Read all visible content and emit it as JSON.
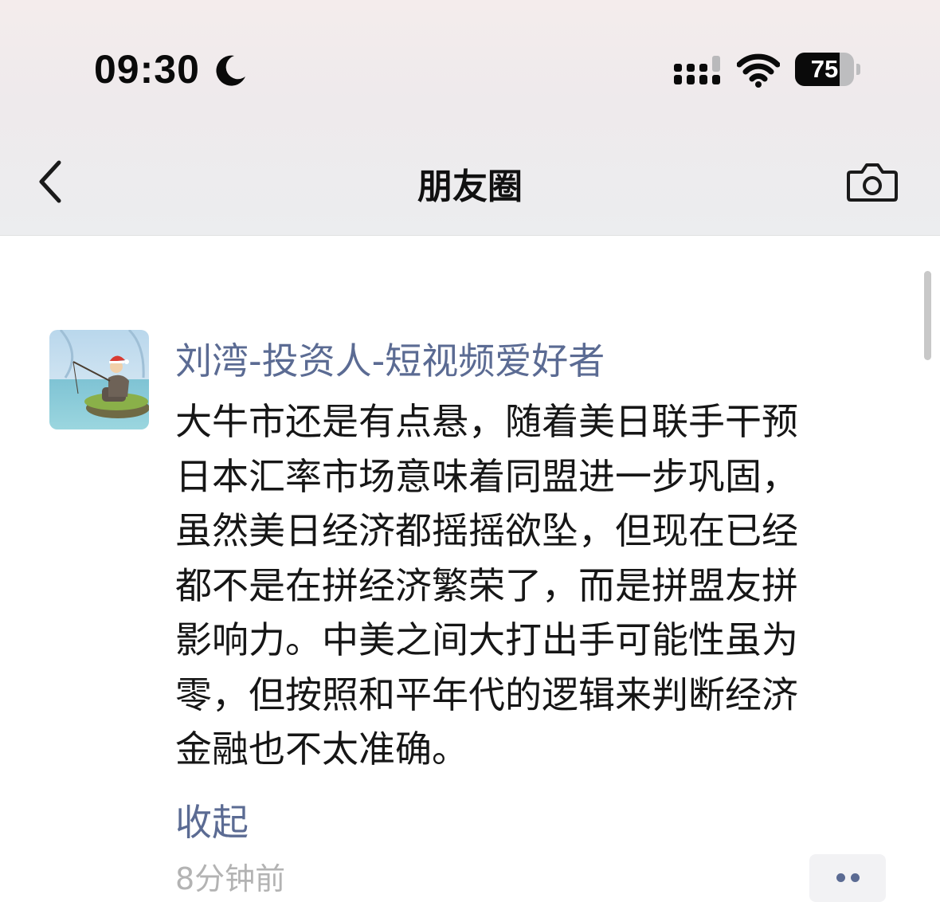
{
  "status_bar": {
    "time": "09:30",
    "battery_percent": "75",
    "battery_level": 0.75,
    "icons": [
      "moon-icon",
      "signal-icon",
      "wifi-icon",
      "battery-icon"
    ]
  },
  "nav": {
    "title": "朋友圈",
    "back_icon": "chevron-left-icon",
    "camera_icon": "camera-icon"
  },
  "post": {
    "author": "刘湾-投资人-短视频爱好者",
    "lines": [
      "大牛市还是有点悬，随着美日联手干预",
      "日本汇率市场意味着同盟进一步巩固，",
      "虽然美日经济都摇摇欲坠，但现在已经",
      "都不是在拼经济繁荣了，而是拼盟友拼",
      "影响力。中美之间大打出手可能性虽为",
      "零，但按照和平年代的逻辑来判断经济",
      "金融也不太准确。"
    ],
    "collapse_label": "收起",
    "time": "8分钟前"
  },
  "colors": {
    "link": "#5b6b93",
    "text": "#161616",
    "muted": "#b3b3b3",
    "header_bg": "#eeeaec"
  }
}
